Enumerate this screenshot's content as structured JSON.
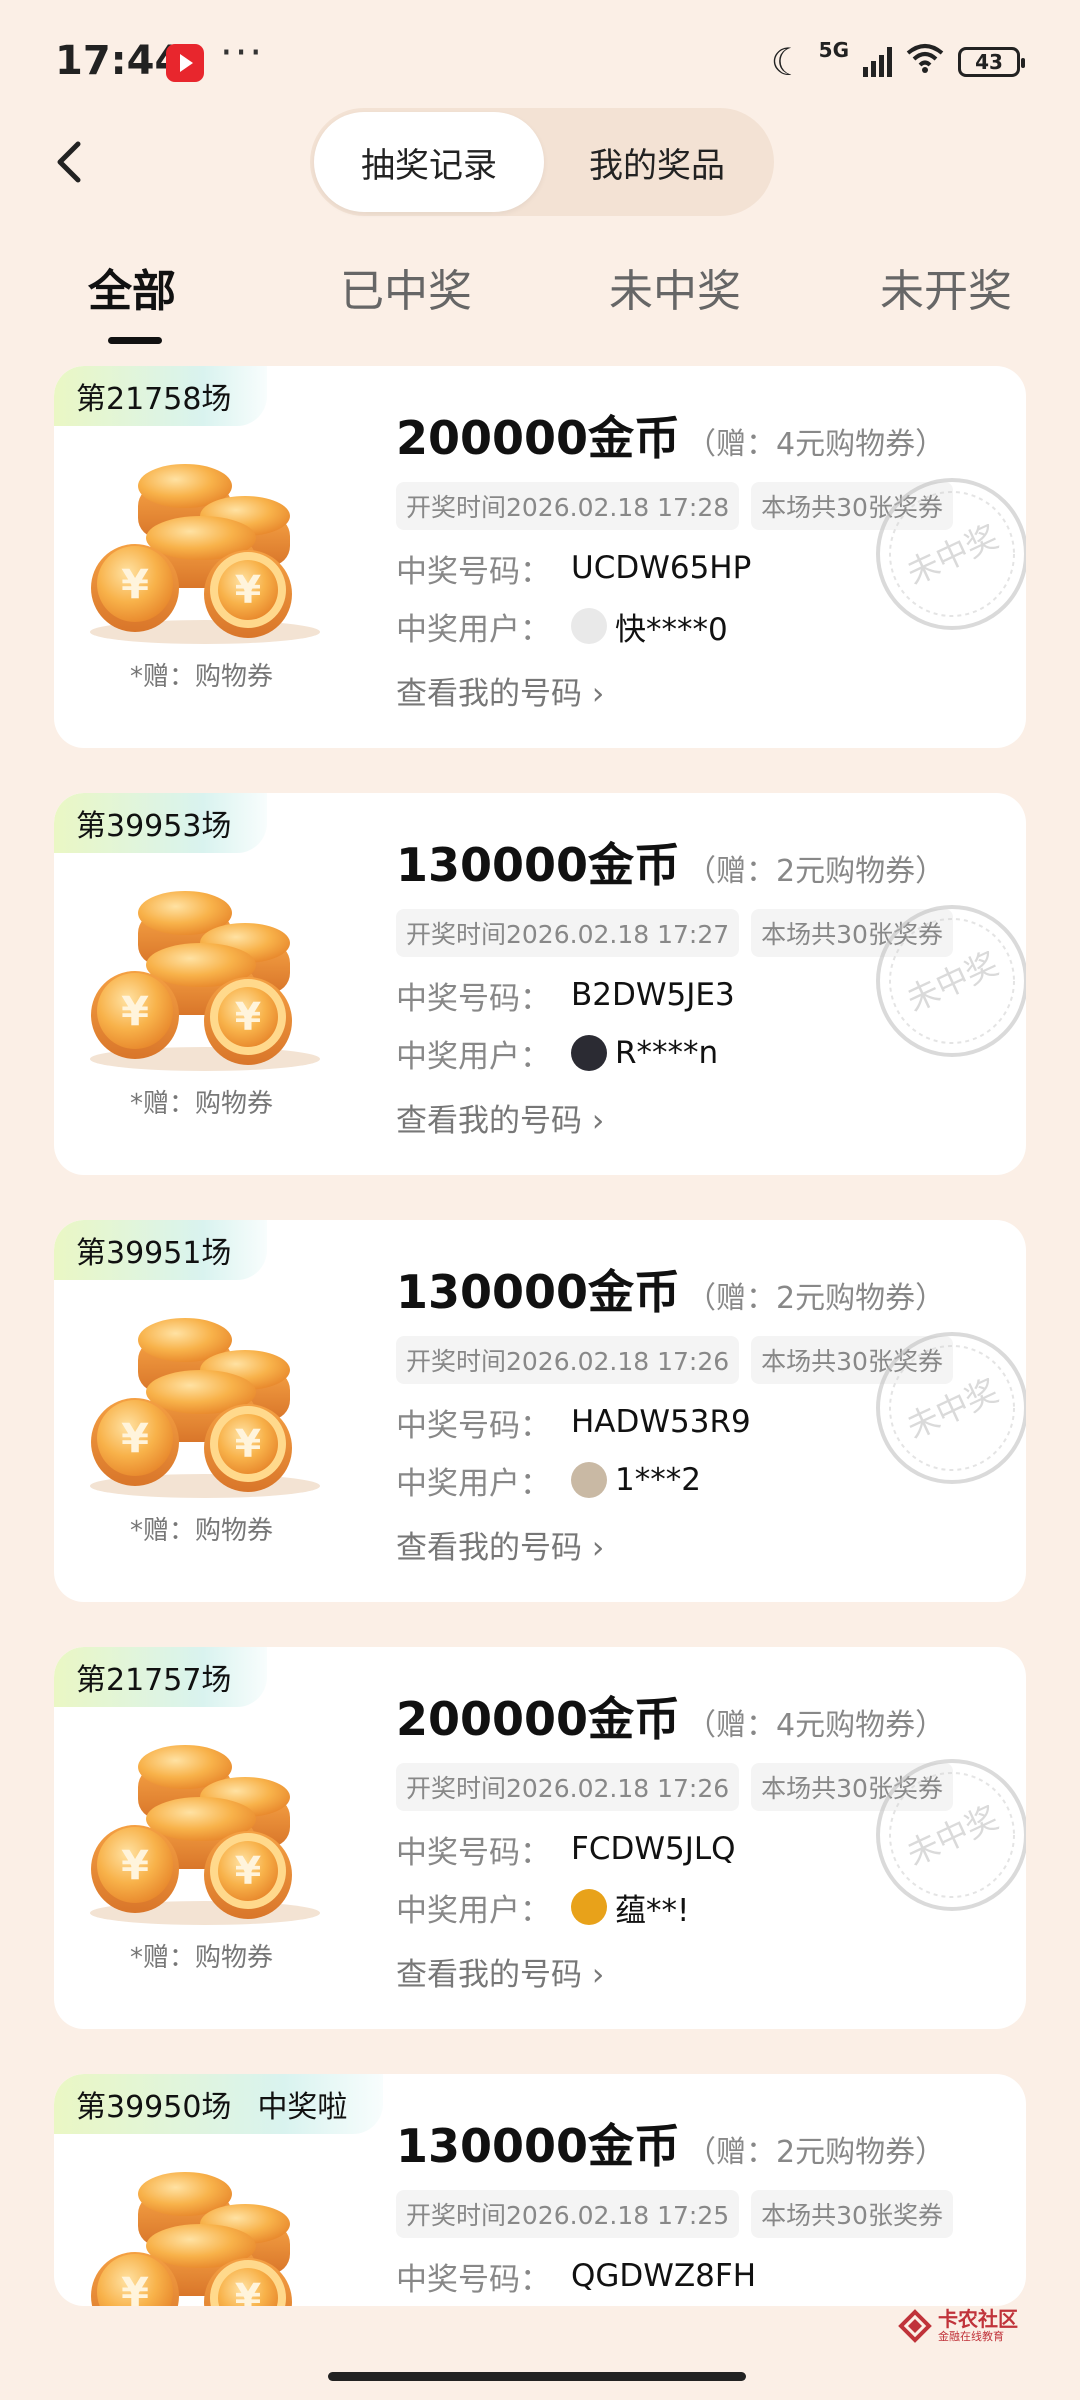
{
  "status_bar": {
    "time": "17:44",
    "network": "5G",
    "battery": "43",
    "icons": [
      "app-icon",
      "more-dots-icon",
      "moon-icon",
      "signal-icon",
      "wifi-icon",
      "battery-icon"
    ]
  },
  "header": {
    "segments": [
      {
        "label": "抽奖记录",
        "active": true
      },
      {
        "label": "我的奖品",
        "active": false
      }
    ]
  },
  "tabs": [
    {
      "label": "全部",
      "active": true
    },
    {
      "label": "已中奖",
      "active": false
    },
    {
      "label": "未中奖",
      "active": false
    },
    {
      "label": "未开奖",
      "active": false
    }
  ],
  "labels": {
    "gift_caption": "*赠：购物券",
    "winning_number": "中奖号码：",
    "winning_user": "中奖用户：",
    "view_my_numbers": "查看我的号码",
    "stamp_text": "未中奖"
  },
  "cards": [
    {
      "round": "第21758场",
      "won": "",
      "title": "200000金币",
      "bonus": "（赠：4元购物券）",
      "draw_time": "开奖时间2026.02.18 17:28",
      "tickets": "本场共30张奖券",
      "number": "UCDW65HP",
      "user": "快****0",
      "stamp": true
    },
    {
      "round": "第39953场",
      "won": "",
      "title": "130000金币",
      "bonus": "（赠：2元购物券）",
      "draw_time": "开奖时间2026.02.18 17:27",
      "tickets": "本场共30张奖券",
      "number": "B2DW5JE3",
      "user": "R****n",
      "stamp": true
    },
    {
      "round": "第39951场",
      "won": "",
      "title": "130000金币",
      "bonus": "（赠：2元购物券）",
      "draw_time": "开奖时间2026.02.18 17:26",
      "tickets": "本场共30张奖券",
      "number": "HADW53R9",
      "user": "1***2",
      "stamp": true
    },
    {
      "round": "第21757场",
      "won": "",
      "title": "200000金币",
      "bonus": "（赠：4元购物券）",
      "draw_time": "开奖时间2026.02.18 17:26",
      "tickets": "本场共30张奖券",
      "number": "FCDW5JLQ",
      "user": "蕴**!",
      "stamp": true
    },
    {
      "round": "第39950场",
      "won": "中奖啦",
      "title": "130000金币",
      "bonus": "（赠：2元购物券）",
      "draw_time": "开奖时间2026.02.18 17:25",
      "tickets": "本场共30张奖券",
      "number": "QGDWZ8FH",
      "user": "",
      "stamp": false
    }
  ],
  "watermark": {
    "title": "卡农社区",
    "subtitle": "金融在线教育"
  },
  "colors": {
    "page_bg": "#fbefe6",
    "card_bg": "#ffffff",
    "coin": "#f3a23a",
    "brand_red": "#c0333a"
  }
}
